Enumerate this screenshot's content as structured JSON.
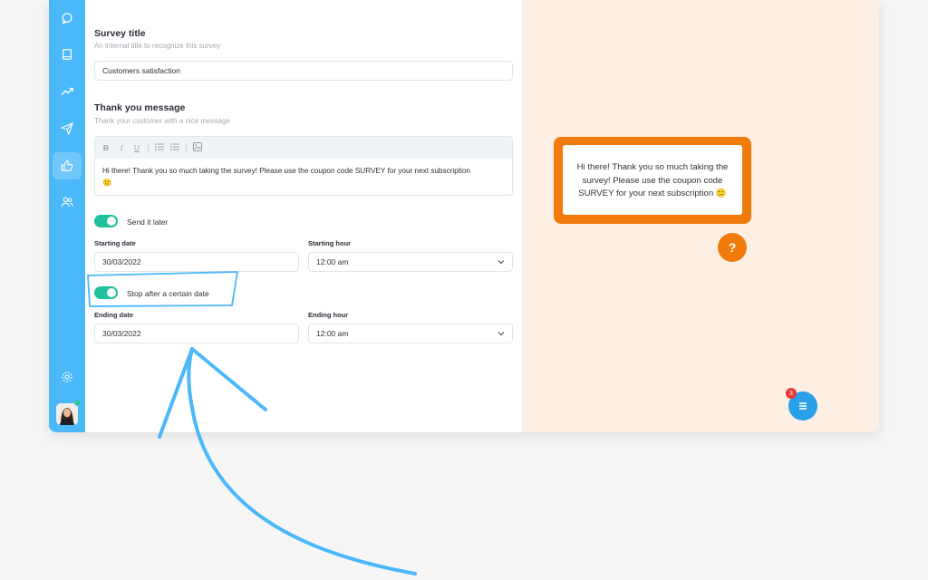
{
  "survey_title": {
    "heading": "Survey title",
    "subheading": "An internal title to recognize this survey",
    "value": "Customers satisfaction"
  },
  "thank_you": {
    "heading": "Thank you message",
    "subheading": "Thank your customer with a nice message",
    "toolbar": {
      "bold": "B",
      "italic": "I",
      "underline": "U"
    },
    "message": "Hi there! Thank you so much taking the survey! Please use the coupon code SURVEY for your next subscription",
    "emoji": "🙂"
  },
  "send_later": {
    "label": "Send it later",
    "enabled": true,
    "starting_date_label": "Starting date",
    "starting_date": "30/03/2022",
    "starting_hour_label": "Starting hour",
    "starting_hour": "12:00 am"
  },
  "stop_after": {
    "label": "Stop after a certain date",
    "enabled": true,
    "ending_date_label": "Ending date",
    "ending_date": "30/03/2022",
    "ending_hour_label": "Ending hour",
    "ending_hour": "12:00 am"
  },
  "preview": {
    "message": "Hi there! Thank you so much taking the survey! Please use the coupon code SURVEY for your next subscription",
    "emoji": "🙂",
    "help_label": "?",
    "chat_badge": "3"
  },
  "colors": {
    "sidebar": "#4bb8f9",
    "toggle_on": "#1fc29a",
    "accent_orange": "#f07b0b",
    "preview_bg": "#fdefe3",
    "annotation": "#4bb8f9"
  },
  "icons": {
    "sidebar": [
      "chat-icon",
      "book-icon",
      "trending-icon",
      "send-icon",
      "thumbs-up-icon",
      "users-icon",
      "settings-icon"
    ],
    "toolbar": [
      "bold-icon",
      "italic-icon",
      "underline-icon",
      "ordered-list-icon",
      "bullet-list-icon",
      "image-icon"
    ]
  }
}
